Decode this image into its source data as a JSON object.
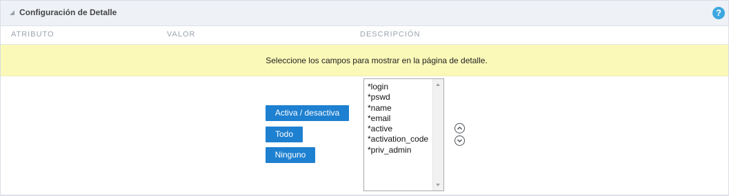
{
  "header": {
    "title": "Configuración de Detalle",
    "help_label": "?"
  },
  "columns": {
    "attribute": "ATRIBUTO",
    "value": "VALOR",
    "description": "DESCRIPCIÓN"
  },
  "notice": "Seleccione los campos para mostrar en la página de detalle.",
  "buttons": {
    "toggle_label": "Activa / desactiva",
    "all_label": "Todo",
    "none_label": "Ninguno"
  },
  "fields": [
    "*login",
    "*pswd",
    "*name",
    "*email",
    "*active",
    "*activation_code",
    "*priv_admin"
  ],
  "icons": {
    "collapse": "collapse-triangle-icon",
    "help": "help-icon",
    "move_up": "chevron-up-circle-icon",
    "move_down": "chevron-down-circle-icon"
  },
  "colors": {
    "button": "#1e80d0",
    "notice_bg": "#fbf9b8",
    "help": "#3fa7e0",
    "header_bg": "#eef1f5"
  }
}
